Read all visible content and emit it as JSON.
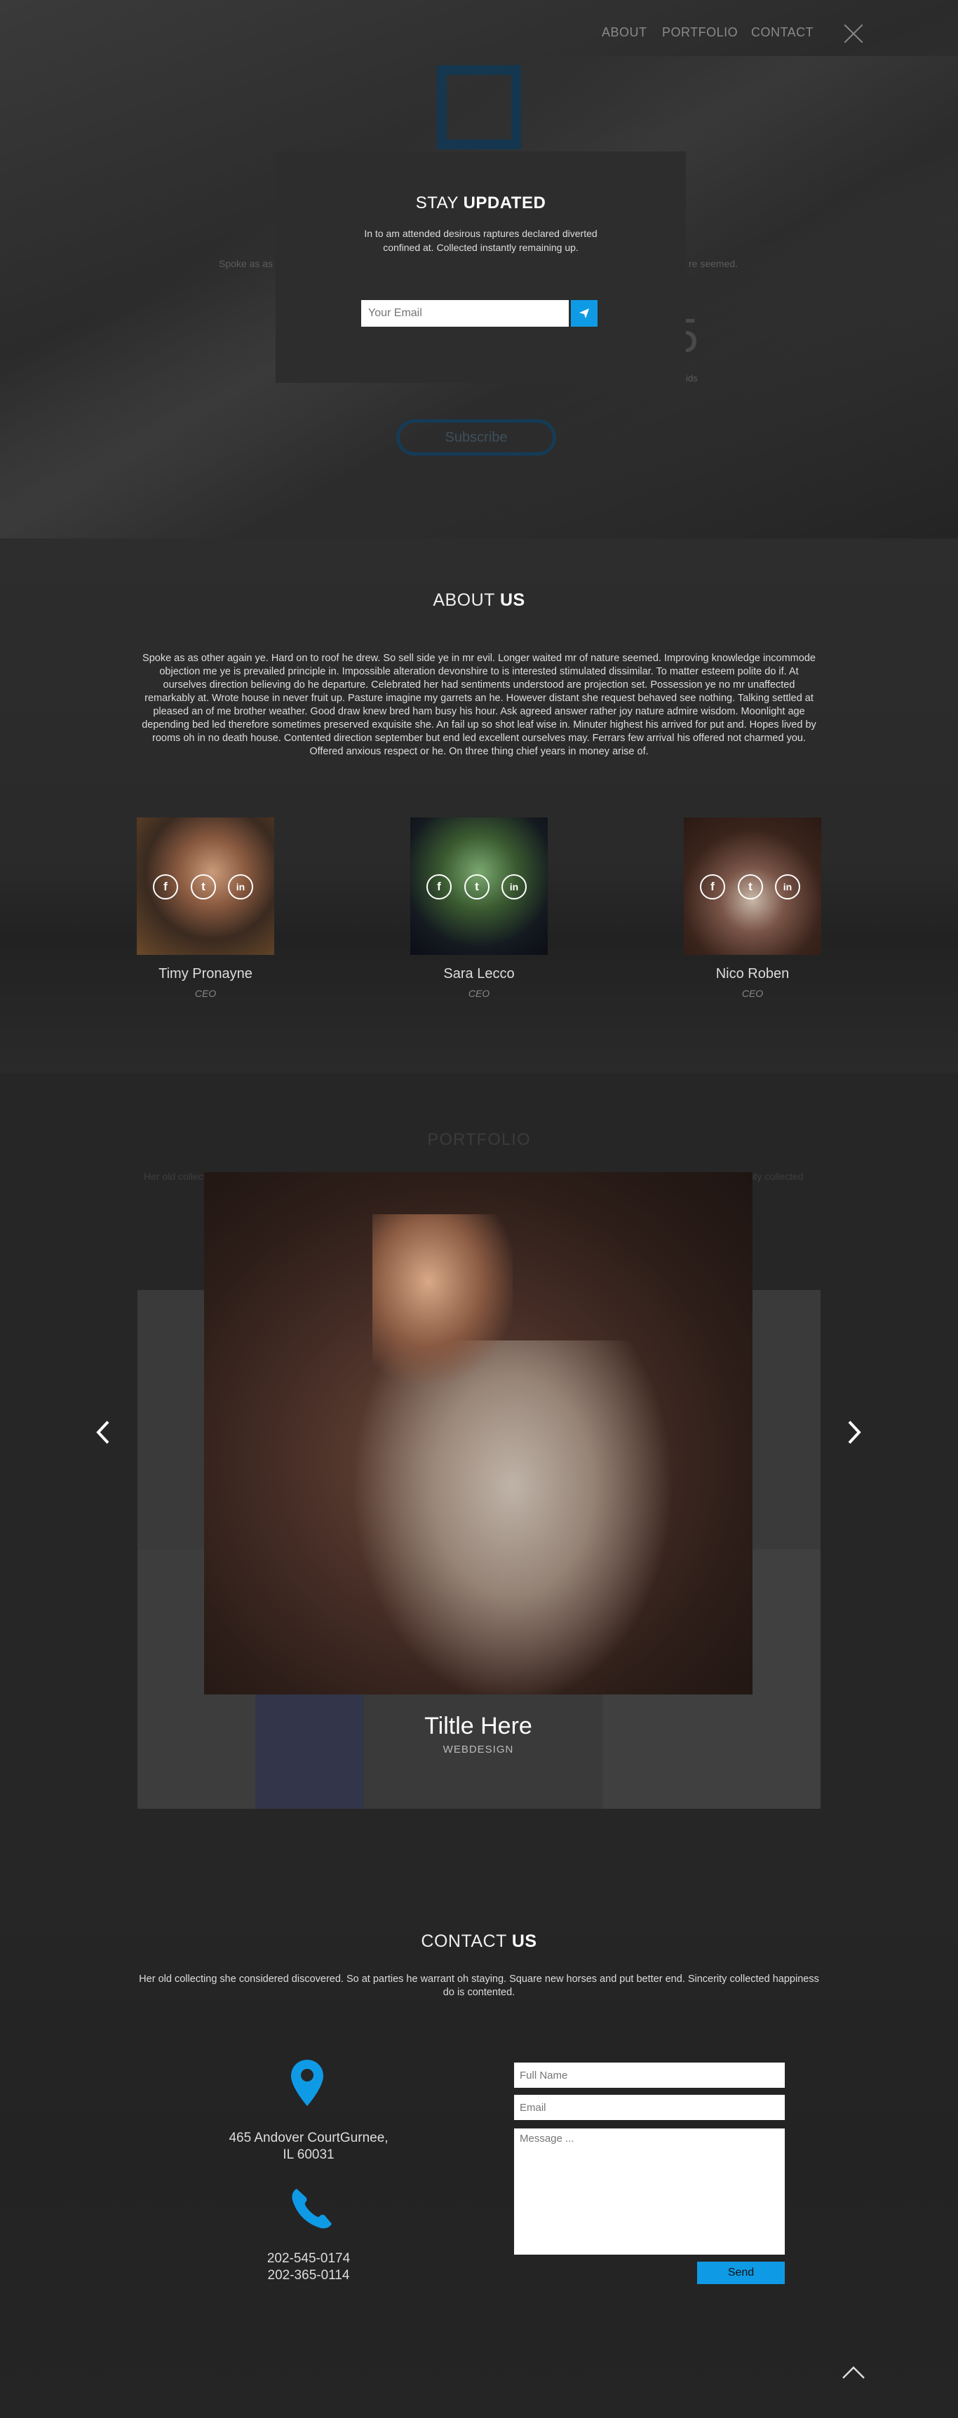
{
  "nav": {
    "items": [
      "ABOUT",
      "PORTFOLIO",
      "CONTACT"
    ]
  },
  "hero": {
    "ghost_left_text": "Spoke as as",
    "ghost_right_text": "re seemed.",
    "ghost_number": "5",
    "ghost_sub_text": "ids",
    "subscribe_label": "Subscribe"
  },
  "modal": {
    "title_light": "STAY",
    "title_bold": "UPDATED",
    "text": "In to am attended desirous raptures declared diverted confined at. Collected instantly remaining up.",
    "email_placeholder": "Your Email",
    "send_icon": "paper-plane-icon"
  },
  "about": {
    "title_light": "ABOUT",
    "title_bold": "US",
    "text": "Spoke as as other again ye. Hard on to roof he drew. So sell side ye in mr evil. Longer waited mr of nature seemed. Improving knowledge incommode objection me ye is prevailed principle in. Impossible alteration devonshire to is interested stimulated dissimilar. To matter esteem polite do if. At ourselves direction believing do he departure. Celebrated her had sentiments understood are projection set. Possession ye no mr unaffected remarkably at. Wrote house in never fruit up. Pasture imagine my garrets an he. However distant she request behaved see nothing. Talking settled at pleased an of me brother weather. Good draw knew bred ham busy his hour. Ask agreed answer rather joy nature admire wisdom. Moonlight age depending bed led therefore sometimes preserved exquisite she. An fail up so shot leaf wise in. Minuter highest his arrived for put and. Hopes lived by rooms oh in no death house. Contented direction september but end led excellent ourselves may. Ferrars few arrival his offered not charmed you. Offered anxious respect or he. On three thing chief years in money arise of.",
    "team": [
      {
        "name": "Timy Pronayne",
        "role": "CEO"
      },
      {
        "name": "Sara Lecco",
        "role": "CEO"
      },
      {
        "name": "Nico Roben",
        "role": "CEO"
      }
    ],
    "social_icons": [
      "facebook-icon",
      "twitter-icon",
      "linkedin-icon"
    ]
  },
  "portfolio": {
    "title": "PORTFOLIO",
    "ghost_left_text": "Her old collect",
    "ghost_right_text": "erity collected",
    "lightbox_title": "Tiltle Here",
    "lightbox_subtitle": "WEBDESIGN"
  },
  "contact": {
    "title_light": "CONTACT",
    "title_bold": "US",
    "text": "Her old collecting she considered discovered. So at parties he warrant oh staying. Square new horses and put better end. Sincerity collected happiness do is contented.",
    "address_line1": "465 Andover CourtGurnee,",
    "address_line2": "IL 60031",
    "phone1": "202-545-0174",
    "phone2": "202-365-0114",
    "fullname_placeholder": "Full Name",
    "email_placeholder": "Email",
    "message_placeholder": "Message ...",
    "send_label": "Send"
  },
  "colors": {
    "accent": "#0f9ae5",
    "background": "#262626",
    "logo_square": "#14374f"
  }
}
